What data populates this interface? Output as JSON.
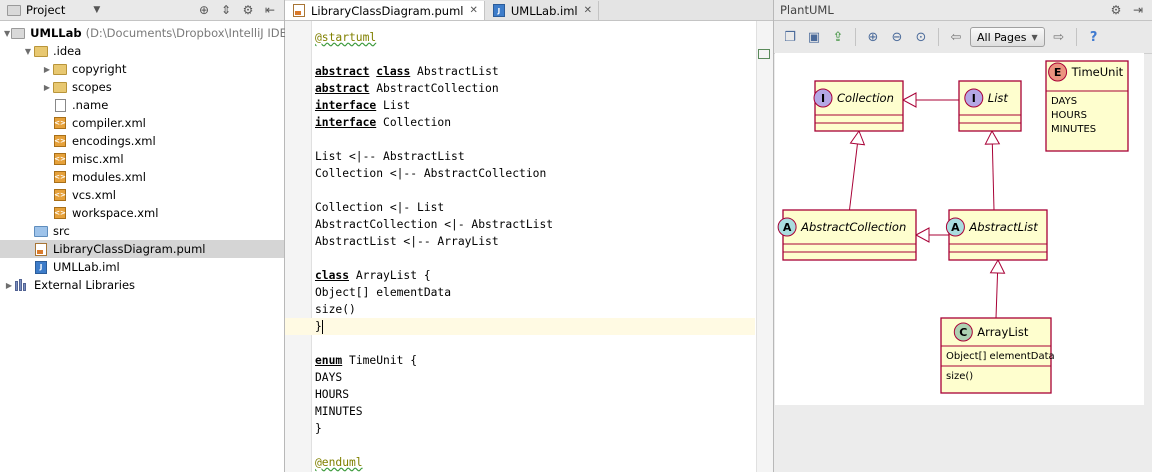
{
  "project": {
    "title": "Project",
    "tree": [
      {
        "label": "UMLLab",
        "extra": "(D:\\Documents\\Dropbox\\IntelliJ IDEA Wo",
        "icon": "module-folder-icon",
        "indent": 0,
        "expanded": true,
        "bold": true
      },
      {
        "label": ".idea",
        "icon": "folder-icon",
        "indent": 1,
        "expanded": true
      },
      {
        "label": "copyright",
        "icon": "folder-icon",
        "indent": 2,
        "expanded": false
      },
      {
        "label": "scopes",
        "icon": "folder-icon",
        "indent": 2,
        "expanded": false
      },
      {
        "label": ".name",
        "icon": "file-icon",
        "indent": 2
      },
      {
        "label": "compiler.xml",
        "icon": "xml-file-icon",
        "indent": 2
      },
      {
        "label": "encodings.xml",
        "icon": "xml-file-icon",
        "indent": 2
      },
      {
        "label": "misc.xml",
        "icon": "xml-file-icon",
        "indent": 2
      },
      {
        "label": "modules.xml",
        "icon": "xml-file-icon",
        "indent": 2
      },
      {
        "label": "vcs.xml",
        "icon": "xml-file-icon",
        "indent": 2
      },
      {
        "label": "workspace.xml",
        "icon": "xml-file-icon",
        "indent": 2
      },
      {
        "label": "src",
        "icon": "source-folder-icon",
        "indent": 1
      },
      {
        "label": "LibraryClassDiagram.puml",
        "icon": "puml-file-icon",
        "indent": 1,
        "selected": true
      },
      {
        "label": "UMLLab.iml",
        "icon": "iml-file-icon",
        "indent": 1
      },
      {
        "label": "External Libraries",
        "icon": "libraries-icon",
        "indent": 0,
        "expanded": false
      }
    ]
  },
  "editor": {
    "tabs": [
      {
        "label": "LibraryClassDiagram.puml",
        "active": true,
        "icon": "puml-file-icon"
      },
      {
        "label": "UMLLab.iml",
        "active": false,
        "icon": "iml-file-icon"
      }
    ],
    "lines": [
      [
        {
          "t": "@startuml",
          "c": "dir"
        }
      ],
      [],
      [
        {
          "t": "abstract",
          "c": "kw"
        },
        {
          "t": " "
        },
        {
          "t": "class",
          "c": "kw"
        },
        {
          "t": " AbstractList"
        }
      ],
      [
        {
          "t": "abstract",
          "c": "kw"
        },
        {
          "t": " AbstractCollection"
        }
      ],
      [
        {
          "t": "interface",
          "c": "kw"
        },
        {
          "t": " List"
        }
      ],
      [
        {
          "t": "interface",
          "c": "kw"
        },
        {
          "t": " Collection"
        }
      ],
      [],
      [
        {
          "t": "List <|-- AbstractList"
        }
      ],
      [
        {
          "t": "Collection <|-- AbstractCollection"
        }
      ],
      [],
      [
        {
          "t": "Collection <|- List"
        }
      ],
      [
        {
          "t": "AbstractCollection <|- AbstractList"
        }
      ],
      [
        {
          "t": "AbstractList <|-- ArrayList"
        }
      ],
      [],
      [
        {
          "t": "class",
          "c": "kw"
        },
        {
          "t": " ArrayList {"
        }
      ],
      [
        {
          "t": "Object[] elementData"
        }
      ],
      [
        {
          "t": "size()"
        }
      ],
      [
        {
          "t": "}"
        }
      ],
      [],
      [
        {
          "t": "enum",
          "c": "kw"
        },
        {
          "t": " TimeUnit {"
        }
      ],
      [
        {
          "t": "DAYS"
        }
      ],
      [
        {
          "t": "HOURS"
        }
      ],
      [
        {
          "t": "MINUTES"
        }
      ],
      [
        {
          "t": "}"
        }
      ],
      [],
      [
        {
          "t": "@enduml",
          "c": "dir"
        }
      ]
    ],
    "current_line": 17
  },
  "plantuml": {
    "title": "PlantUML",
    "pages_select": "All Pages",
    "diagram": {
      "classes": [
        {
          "id": "Collection",
          "name": "Collection",
          "stereotype": "I",
          "italic": true,
          "fields": [],
          "methods": []
        },
        {
          "id": "List",
          "name": "List",
          "stereotype": "I",
          "italic": true,
          "fields": [],
          "methods": []
        },
        {
          "id": "TimeUnit",
          "name": "TimeUnit",
          "stereotype": "E",
          "italic": false,
          "fields": [
            "DAYS",
            "HOURS",
            "MINUTES"
          ],
          "methods": []
        },
        {
          "id": "AbstractCollection",
          "name": "AbstractCollection",
          "stereotype": "A",
          "italic": true,
          "fields": [],
          "methods": []
        },
        {
          "id": "AbstractList",
          "name": "AbstractList",
          "stereotype": "A",
          "italic": true,
          "fields": [],
          "methods": []
        },
        {
          "id": "ArrayList",
          "name": "ArrayList",
          "stereotype": "C",
          "italic": false,
          "fields": [
            "Object[] elementData"
          ],
          "methods": [
            "size()"
          ]
        }
      ],
      "relations": [
        {
          "from": "List",
          "to": "Collection"
        },
        {
          "from": "AbstractCollection",
          "to": "Collection"
        },
        {
          "from": "AbstractList",
          "to": "List"
        },
        {
          "from": "AbstractList",
          "to": "AbstractCollection"
        },
        {
          "from": "ArrayList",
          "to": "AbstractList"
        }
      ],
      "colors": {
        "box_fill": "#fefece",
        "box_stroke": "#a80036",
        "interface_badge": "#b4a7e5",
        "abstract_badge": "#a9dcdf",
        "class_badge": "#add1b2",
        "enum_badge": "#eb937f"
      }
    }
  }
}
